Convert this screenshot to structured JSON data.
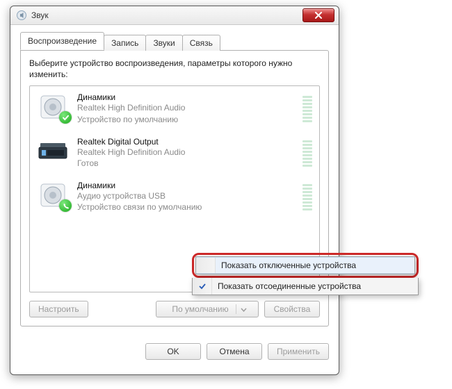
{
  "window": {
    "title": "Звук"
  },
  "tabs": [
    {
      "label": "Воспроизведение",
      "active": true
    },
    {
      "label": "Запись"
    },
    {
      "label": "Звуки"
    },
    {
      "label": "Связь"
    }
  ],
  "instructions": "Выберите устройство воспроизведения, параметры которого нужно изменить:",
  "devices": [
    {
      "name": "Динамики",
      "line2": "Realtek High Definition Audio",
      "line3": "Устройство по умолчанию",
      "icon": "speaker",
      "badge": "check"
    },
    {
      "name": "Realtek Digital Output",
      "line2": "Realtek High Definition Audio",
      "line3": "Готов",
      "icon": "spdif",
      "badge": null
    },
    {
      "name": "Динамики",
      "line2": "Аудио устройства USB",
      "line3": "Устройство связи по умолчанию",
      "icon": "speaker",
      "badge": "phone"
    }
  ],
  "panel_buttons": {
    "configure": "Настроить",
    "set_default": "По умолчанию",
    "properties": "Свойства"
  },
  "dialog_buttons": {
    "ok": "OK",
    "cancel": "Отмена",
    "apply": "Применить"
  },
  "context_menu": {
    "items": [
      {
        "label": "Показать отключенные устройства",
        "checked": false,
        "highlighted": true
      },
      {
        "label": "Показать отсоединенные устройства",
        "checked": true
      }
    ]
  }
}
